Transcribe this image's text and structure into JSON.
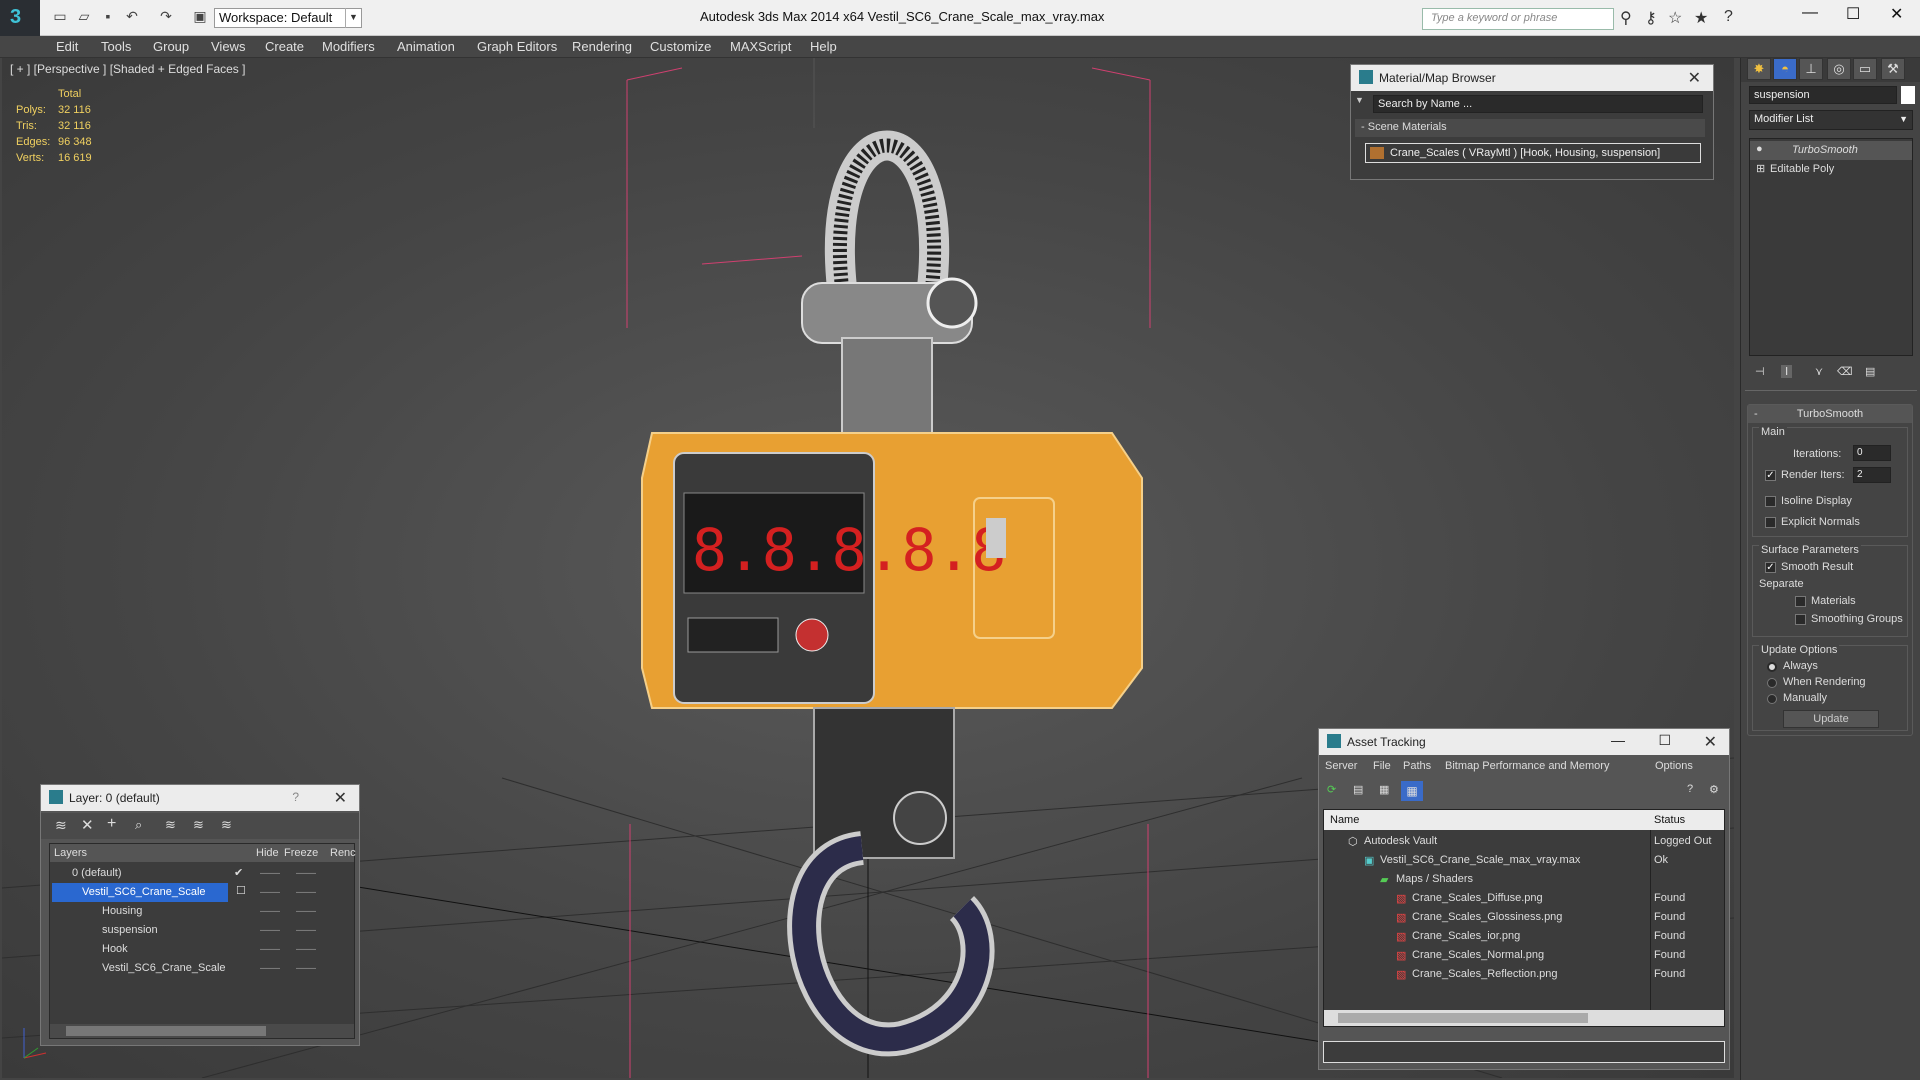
{
  "titlebar": {
    "workspace": "Workspace: Default",
    "title": "Autodesk 3ds Max  2014 x64      Vestil_SC6_Crane_Scale_max_vray.max",
    "search_placeholder": "Type a keyword or phrase"
  },
  "menu": [
    "Edit",
    "Tools",
    "Group",
    "Views",
    "Create",
    "Modifiers",
    "Animation",
    "Graph Editors",
    "Rendering",
    "Customize",
    "MAXScript",
    "Help"
  ],
  "viewport": {
    "label": "[ + ] [Perspective ] [Shaded + Edged Faces ]",
    "stats_title": "Total",
    "stats": [
      {
        "k": "Polys:",
        "v": "32 116"
      },
      {
        "k": "Tris:",
        "v": "32 116"
      },
      {
        "k": "Edges:",
        "v": "96 348"
      },
      {
        "k": "Verts:",
        "v": "16 619"
      }
    ],
    "display_digits": "8.8.8.8.8"
  },
  "material_browser": {
    "title": "Material/Map Browser",
    "search": "Search by Name ...",
    "group": "Scene Materials",
    "item": "Crane_Scales  ( VRayMtl ) [Hook, Housing, suspension]"
  },
  "layer_panel": {
    "title": "Layer: 0 (default)",
    "help": "?",
    "cols": [
      "Layers",
      "Hide",
      "Freeze",
      "Renc"
    ],
    "rows": [
      {
        "name": "0 (default)",
        "level": 1,
        "selected": false
      },
      {
        "name": "Vestil_SC6_Crane_Scale",
        "level": 1,
        "selected": true
      },
      {
        "name": "Housing",
        "level": 2,
        "selected": false
      },
      {
        "name": "suspension",
        "level": 2,
        "selected": false
      },
      {
        "name": "Hook",
        "level": 2,
        "selected": false
      },
      {
        "name": "Vestil_SC6_Crane_Scale",
        "level": 2,
        "selected": false
      }
    ]
  },
  "asset_tracking": {
    "title": "Asset Tracking",
    "menu": [
      "Server",
      "File",
      "Paths",
      "Bitmap Performance and Memory",
      "Options"
    ],
    "col_name": "Name",
    "col_status": "Status",
    "rows": [
      {
        "name": "Autodesk Vault",
        "status": "Logged Out",
        "level": 1,
        "icon": "vault"
      },
      {
        "name": "Vestil_SC6_Crane_Scale_max_vray.max",
        "status": "Ok",
        "level": 2,
        "icon": "max"
      },
      {
        "name": "Maps / Shaders",
        "status": "",
        "level": 3,
        "icon": "folder"
      },
      {
        "name": "Crane_Scales_Diffuse.png",
        "status": "Found",
        "level": 4,
        "icon": "png"
      },
      {
        "name": "Crane_Scales_Glossiness.png",
        "status": "Found",
        "level": 4,
        "icon": "png"
      },
      {
        "name": "Crane_Scales_ior.png",
        "status": "Found",
        "level": 4,
        "icon": "png"
      },
      {
        "name": "Crane_Scales_Normal.png",
        "status": "Found",
        "level": 4,
        "icon": "png"
      },
      {
        "name": "Crane_Scales_Reflection.png",
        "status": "Found",
        "level": 4,
        "icon": "png"
      }
    ]
  },
  "command_panel": {
    "object_name": "suspension",
    "modifier_list": "Modifier List",
    "stack": [
      "TurboSmooth",
      "Editable Poly"
    ],
    "rollout_title": "TurboSmooth",
    "main": "Main",
    "iterations_label": "Iterations:",
    "iterations": "0",
    "render_iters_label": "Render Iters:",
    "render_iters": "2",
    "isoline": "Isoline Display",
    "explicit": "Explicit Normals",
    "surface": "Surface Parameters",
    "smooth_result": "Smooth Result",
    "separate": "Separate",
    "materials": "Materials",
    "smoothing_groups": "Smoothing Groups",
    "update_options": "Update Options",
    "always": "Always",
    "when_rendering": "When Rendering",
    "manually": "Manually",
    "update": "Update"
  }
}
